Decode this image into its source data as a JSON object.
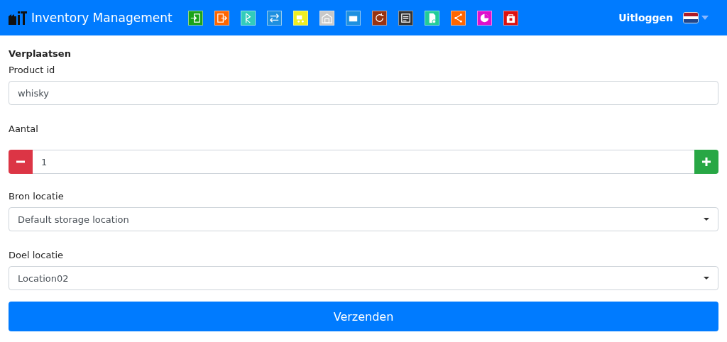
{
  "navbar": {
    "brand": "Inventory Management",
    "tools": [
      {
        "kind": "login",
        "color": "#1aa31a"
      },
      {
        "kind": "logout",
        "color": "#ff6600"
      },
      {
        "kind": "scan",
        "color": "#33ccbb"
      },
      {
        "kind": "transfer",
        "color": "#1e8fe0"
      },
      {
        "kind": "truck",
        "color": "#eeee22"
      },
      {
        "kind": "warehouse",
        "color": "#c8c8c8"
      },
      {
        "kind": "box",
        "color": "#1e90e0"
      },
      {
        "kind": "refresh",
        "color": "#993311"
      },
      {
        "kind": "list",
        "color": "#333333"
      },
      {
        "kind": "document",
        "color": "#22cc99"
      },
      {
        "kind": "share",
        "color": "#ff6600"
      },
      {
        "kind": "chart",
        "color": "#dd11cc"
      },
      {
        "kind": "store",
        "color": "#dd1111"
      }
    ],
    "logout": "Uitloggen"
  },
  "form": {
    "title": "Verplaatsen",
    "product_label": "Product id",
    "product_value": "whisky",
    "quantity_label": "Aantal",
    "quantity_value": "1",
    "source_label": "Bron locatie",
    "source_value": "Default storage location",
    "target_label": "Doel locatie",
    "target_value": "Location02",
    "submit": "Verzenden"
  }
}
